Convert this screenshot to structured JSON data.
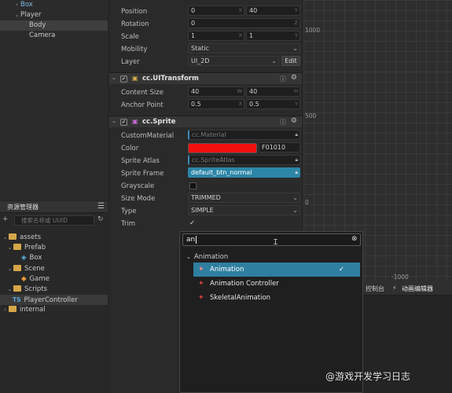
{
  "hierarchy": {
    "items": [
      {
        "label": "Box"
      },
      {
        "label": "Player"
      },
      {
        "label": "Body"
      },
      {
        "label": "Camera"
      }
    ]
  },
  "assets": {
    "tab_title": "资源管理器",
    "search_placeholder": "搜索名称或 UUID",
    "items": [
      {
        "label": "assets"
      },
      {
        "label": "Prefab"
      },
      {
        "label": "Box"
      },
      {
        "label": "Scene"
      },
      {
        "label": "Game"
      },
      {
        "label": "Scripts"
      },
      {
        "label": "PlayerController"
      },
      {
        "label": "internal"
      }
    ]
  },
  "inspector": {
    "position": {
      "label": "Position",
      "x": "0",
      "y": "40",
      "x_axis": "X",
      "y_axis": "Y"
    },
    "rotation": {
      "label": "Rotation",
      "value": "0",
      "axis": "Z"
    },
    "scale": {
      "label": "Scale",
      "x": "1",
      "y": "1",
      "x_axis": "X",
      "y_axis": "Y"
    },
    "mobility": {
      "label": "Mobility",
      "value": "Static"
    },
    "layer": {
      "label": "Layer",
      "value": "UI_2D",
      "edit": "Edit"
    },
    "uitransform": {
      "title": "cc.UITransform",
      "content_size": {
        "label": "Content Size",
        "w": "40",
        "h": "40",
        "w_axis": "W",
        "h_axis": "H"
      },
      "anchor": {
        "label": "Anchor Point",
        "x": "0.5",
        "y": "0.5",
        "x_axis": "X",
        "y_axis": "Y"
      }
    },
    "sprite": {
      "title": "cc.Sprite",
      "custom_material": {
        "label": "CustomMaterial",
        "value": "cc.Material"
      },
      "color": {
        "label": "Color",
        "hex": "F01010",
        "swatch": "#F01010"
      },
      "sprite_atlas": {
        "label": "Sprite Atlas",
        "value": "cc.SpriteAtlas"
      },
      "sprite_frame": {
        "label": "Sprite Frame",
        "value": "default_btn_normal"
      },
      "grayscale": {
        "label": "Grayscale"
      },
      "size_mode": {
        "label": "Size Mode",
        "value": "TRIMMED"
      },
      "type": {
        "label": "Type",
        "value": "SIMPLE"
      },
      "trim": {
        "label": "Trim",
        "check": "✓"
      }
    }
  },
  "scene": {
    "ruler_labels": [
      "1000",
      "500",
      "0",
      "-1000"
    ]
  },
  "bottom_tabs": {
    "console": "控制台",
    "animation_editor": "动画编辑器"
  },
  "popup": {
    "query": "an",
    "group_label": "Animation",
    "items": [
      {
        "label": "Animation",
        "check": "✓"
      },
      {
        "label": "Animation Controller"
      },
      {
        "label": "SkeletalAnimation"
      }
    ]
  },
  "watermark": "@游戏开发学习日志",
  "colors": {
    "accent": "#2f7fa0",
    "swatch": "#F01010"
  }
}
